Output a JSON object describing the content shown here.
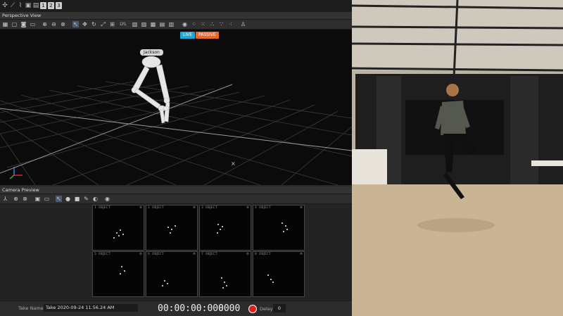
{
  "panels": {
    "perspective_title": "Perspective View",
    "camera_preview_title": "Camera Preview"
  },
  "viewport": {
    "live_badge": "LIVE",
    "passive_badge": "PASSIVE",
    "skeleton_tag": "Jackson"
  },
  "toolbar": {
    "layout_label": "LYL"
  },
  "topbar": {
    "numbers": [
      "1",
      "2",
      "3"
    ]
  },
  "cameras": [
    {
      "index": "1",
      "label": "OBJECT"
    },
    {
      "index": "2",
      "label": "OBJECT"
    },
    {
      "index": "3",
      "label": "OBJECT"
    },
    {
      "index": "4",
      "label": "OBJECT"
    },
    {
      "index": "5",
      "label": "OBJECT"
    },
    {
      "index": "6",
      "label": "OBJECT"
    },
    {
      "index": "7",
      "label": "OBJECT"
    },
    {
      "index": "8",
      "label": "OBJECT"
    }
  ],
  "status": {
    "take_label": "Take Name:",
    "take_value": "Take 2020-09-24 11.56.24 AM",
    "timecode": "00:00:00:000",
    "frames": "0000",
    "delay_label": "Delay",
    "delay_value": "0"
  },
  "colors": {
    "live": "#1aa7d9",
    "passive": "#e8672a",
    "record": "#e02020"
  }
}
